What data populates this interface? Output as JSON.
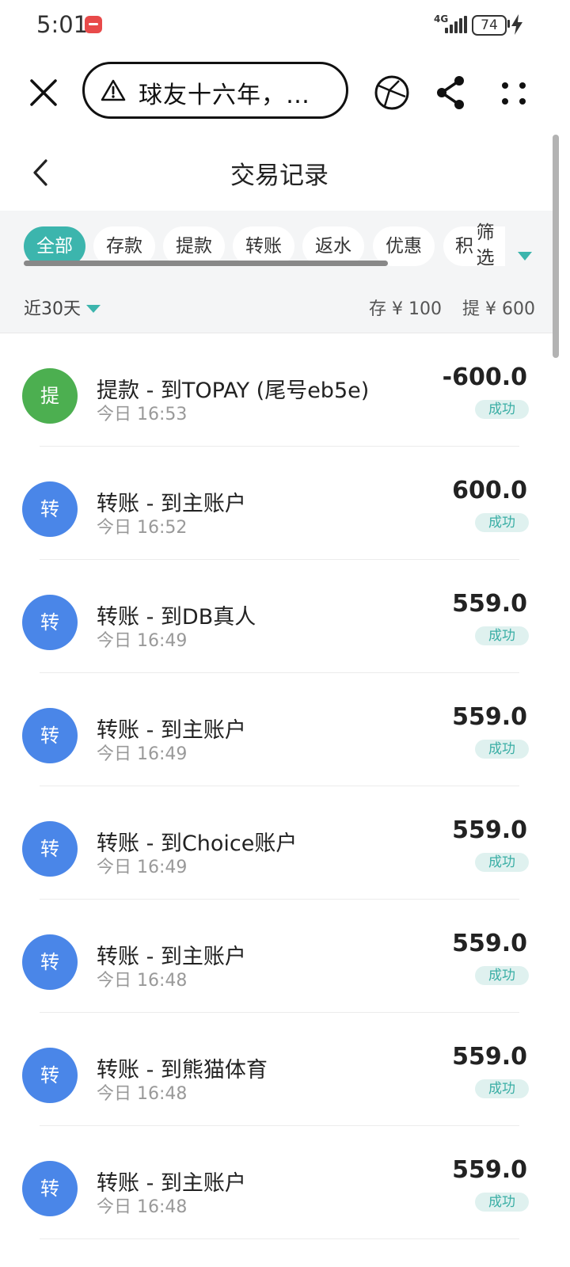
{
  "status_bar": {
    "time": "5:01",
    "network": "4G",
    "battery": "74"
  },
  "browser": {
    "url_text": "球友十六年，…"
  },
  "page": {
    "title": "交易记录"
  },
  "filters": {
    "tabs": [
      "全部",
      "存款",
      "提款",
      "转账",
      "返水",
      "优惠",
      "积"
    ],
    "active_index": 0,
    "filter_label": "筛选",
    "period": "近30天",
    "deposit_summary": "存 ¥ 100",
    "withdraw_summary": "提 ¥ 600"
  },
  "colors": {
    "accent": "#3cb5ad",
    "withdraw_badge": "#4caf50",
    "transfer_badge": "#4a86e8",
    "status_bg": "#dff1ef",
    "status_text": "#3aaea5"
  },
  "transactions": [
    {
      "badge": "提",
      "type": "withdraw",
      "title": "提款 - 到TOPAY (尾号eb5e)",
      "time": "今日 16:53",
      "amount": "-600.0",
      "status": "成功"
    },
    {
      "badge": "转",
      "type": "transfer",
      "title": "转账 - 到主账户",
      "time": "今日 16:52",
      "amount": "600.0",
      "status": "成功"
    },
    {
      "badge": "转",
      "type": "transfer",
      "title": "转账 - 到DB真人",
      "time": "今日 16:49",
      "amount": "559.0",
      "status": "成功"
    },
    {
      "badge": "转",
      "type": "transfer",
      "title": "转账 - 到主账户",
      "time": "今日 16:49",
      "amount": "559.0",
      "status": "成功"
    },
    {
      "badge": "转",
      "type": "transfer",
      "title": "转账 - 到Choice账户",
      "time": "今日 16:49",
      "amount": "559.0",
      "status": "成功"
    },
    {
      "badge": "转",
      "type": "transfer",
      "title": "转账 - 到主账户",
      "time": "今日 16:48",
      "amount": "559.0",
      "status": "成功"
    },
    {
      "badge": "转",
      "type": "transfer",
      "title": "转账 - 到熊猫体育",
      "time": "今日 16:48",
      "amount": "559.0",
      "status": "成功"
    },
    {
      "badge": "转",
      "type": "transfer",
      "title": "转账 - 到主账户",
      "time": "今日 16:48",
      "amount": "559.0",
      "status": "成功"
    }
  ]
}
